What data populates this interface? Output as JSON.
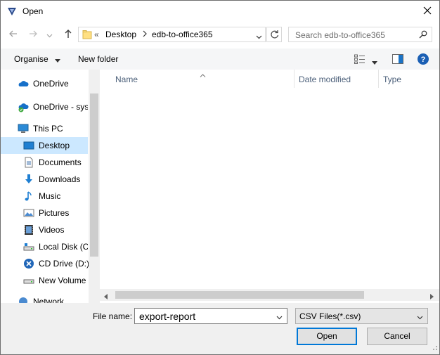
{
  "window": {
    "title": "Open"
  },
  "navigation": {
    "address_prefix": "«",
    "breadcrumbs": [
      "Desktop",
      "edb-to-office365"
    ],
    "search_placeholder": "Search edb-to-office365"
  },
  "toolbar": {
    "organise_label": "Organise",
    "new_folder_label": "New folder"
  },
  "sidebar": {
    "items": [
      {
        "label": "OneDrive",
        "icon": "cloud-icon"
      },
      {
        "label": "OneDrive - syst",
        "icon": "cloud-check-icon"
      },
      {
        "label": "This PC",
        "icon": "computer-icon"
      },
      {
        "label": "Desktop",
        "icon": "desktop-icon",
        "selected": true
      },
      {
        "label": "Documents",
        "icon": "document-icon"
      },
      {
        "label": "Downloads",
        "icon": "download-icon"
      },
      {
        "label": "Music",
        "icon": "music-icon"
      },
      {
        "label": "Pictures",
        "icon": "picture-icon"
      },
      {
        "label": "Videos",
        "icon": "video-icon"
      },
      {
        "label": "Local Disk (C:",
        "icon": "local-disk-icon"
      },
      {
        "label": "CD Drive (D:)",
        "icon": "cd-drive-icon"
      },
      {
        "label": "New Volume",
        "icon": "drive-icon"
      },
      {
        "label": "Network",
        "icon": "network-icon"
      }
    ]
  },
  "list": {
    "columns": [
      {
        "label": "Name"
      },
      {
        "label": "Date modified"
      },
      {
        "label": "Type"
      }
    ]
  },
  "footer": {
    "file_name_label": "File name:",
    "file_name_value": "export-report",
    "file_type_value": "CSV Files(*.csv)",
    "open_label": "Open",
    "cancel_label": "Cancel"
  },
  "colors": {
    "selection": "#cce8ff",
    "accent": "#0078d7",
    "header_text": "#4c607a"
  }
}
